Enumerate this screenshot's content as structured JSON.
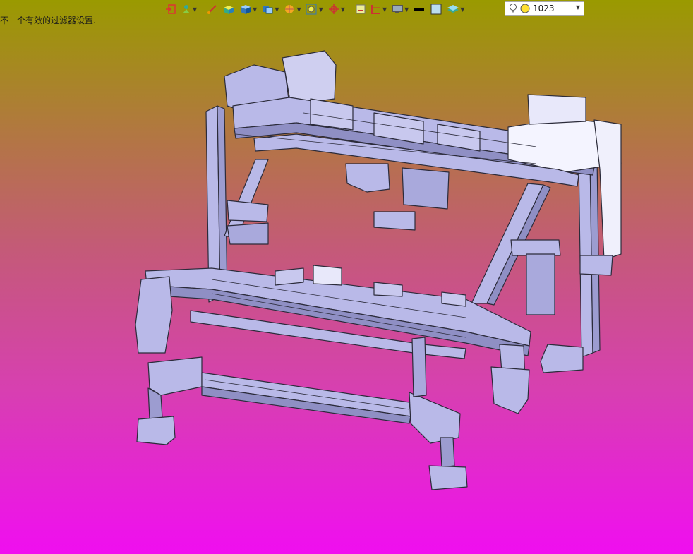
{
  "status": {
    "message": "不一个有效的过滤器设置."
  },
  "toolbar": {
    "items": [
      {
        "icon": "exit-sketch-icon",
        "dropdown": false
      },
      {
        "icon": "view-orientation-icon",
        "dropdown": true
      },
      {
        "icon": "smart-dimension-icon",
        "dropdown": false
      },
      {
        "icon": "box-select-icon",
        "dropdown": false
      },
      {
        "icon": "cube-view-icon",
        "dropdown": true
      },
      {
        "icon": "display-style-icon",
        "dropdown": true
      },
      {
        "icon": "section-view-icon",
        "dropdown": true
      },
      {
        "icon": "zoom-icon",
        "dropdown": true
      },
      {
        "icon": "rotate-icon",
        "dropdown": true
      },
      {
        "icon": "layout-icon",
        "dropdown": false
      },
      {
        "icon": "split-view-icon",
        "dropdown": true
      },
      {
        "icon": "monitor-icon",
        "dropdown": true
      },
      {
        "icon": "line-style-icon",
        "dropdown": false
      },
      {
        "icon": "color-swatch-icon",
        "dropdown": false
      },
      {
        "icon": "layer-icon",
        "dropdown": true
      }
    ],
    "level": {
      "value": "1023",
      "icons": [
        "lightbulb-icon",
        "sun-icon"
      ]
    }
  },
  "colors": {
    "background_top": "#9a9a00",
    "background_bottom": "#f00ef0",
    "model_face": "#b9b9e8",
    "model_edge": "#2b2b3a"
  }
}
